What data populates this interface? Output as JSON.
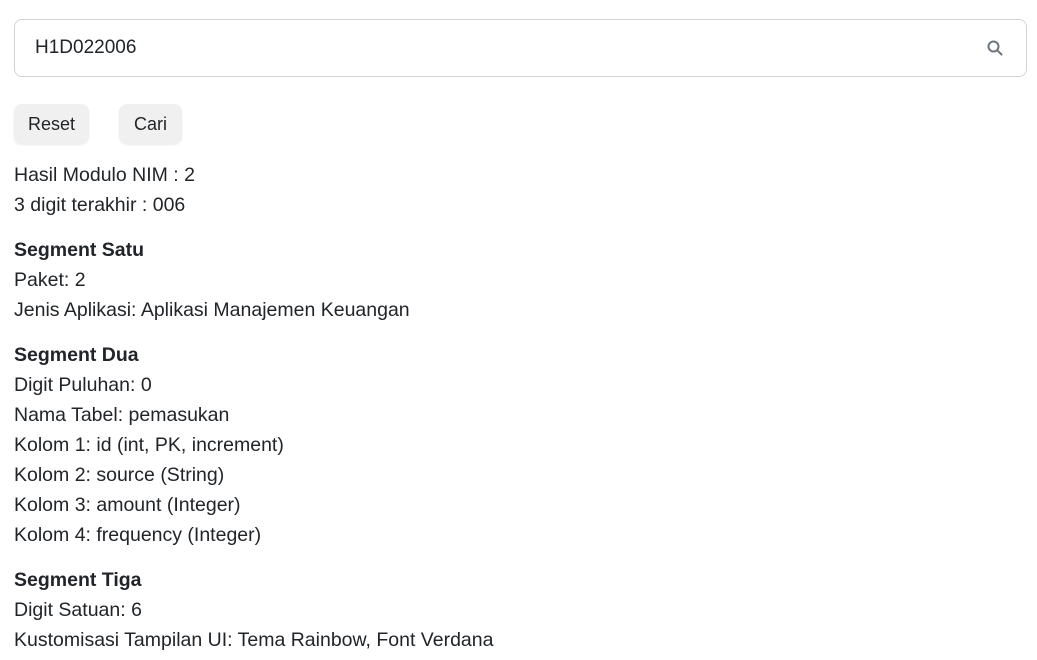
{
  "search": {
    "value": "H1D022006",
    "icon": "search-icon"
  },
  "buttons": {
    "reset_label": "Reset",
    "cari_label": "Cari"
  },
  "summary": {
    "modulo": "Hasil Modulo NIM : 2",
    "last_digits": "3 digit terakhir : 006"
  },
  "segment_satu": {
    "title": "Segment Satu",
    "lines": [
      "Paket: 2",
      "Jenis Aplikasi: Aplikasi Manajemen Keuangan"
    ]
  },
  "segment_dua": {
    "title": "Segment Dua",
    "lines": [
      "Digit Puluhan: 0",
      "Nama Tabel: pemasukan",
      "Kolom 1: id (int, PK, increment)",
      "Kolom 2: source (String)",
      "Kolom 3: amount (Integer)",
      "Kolom 4: frequency (Integer)"
    ]
  },
  "segment_tiga": {
    "title": "Segment Tiga",
    "lines": [
      "Digit Satuan: 6",
      "Kustomisasi Tampilan UI: Tema Rainbow, Font Verdana"
    ]
  }
}
